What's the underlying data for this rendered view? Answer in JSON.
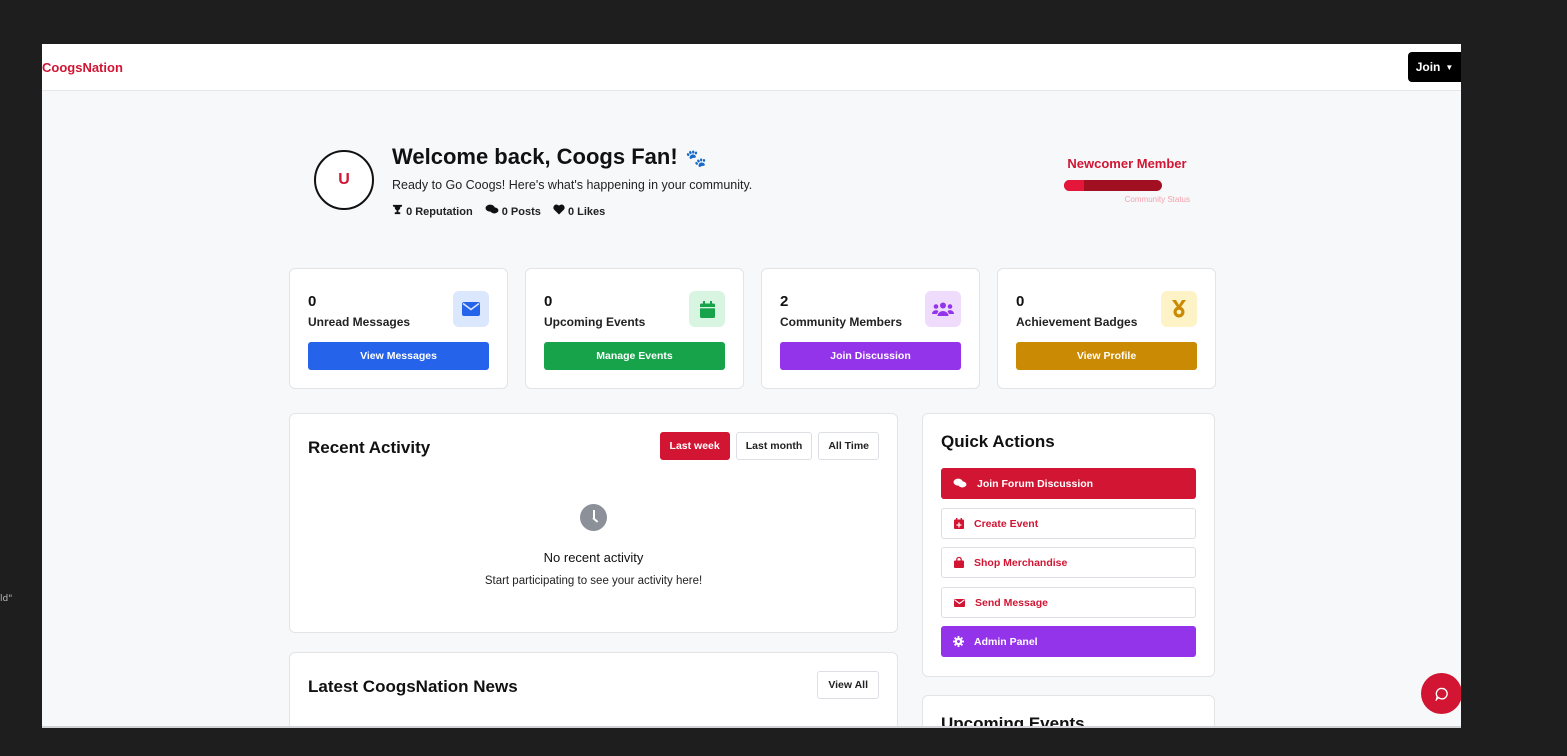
{
  "outer": {
    "left_fragment": "ld\""
  },
  "navbar": {
    "brand": "CoogsNation",
    "join_label": "Join",
    "join_caret": "▼"
  },
  "welcome": {
    "avatar_letter": "U",
    "title": "Welcome back, Coogs Fan!",
    "title_emoji": "🐾",
    "subtitle": "Ready to Go Coogs! Here's what's happening in your community.",
    "stats": [
      {
        "icon": "trophy-icon",
        "label": "0 Reputation"
      },
      {
        "icon": "comments-icon",
        "label": "0 Posts"
      },
      {
        "icon": "heart-icon",
        "label": "0 Likes"
      }
    ]
  },
  "member": {
    "label": "Newcomer Member",
    "status": "Community Status",
    "progress": 0.2
  },
  "cards": [
    {
      "value": "0",
      "label": "Unread Messages",
      "button": "View Messages",
      "icon": "envelope-icon",
      "color": "#2563eb",
      "icon_bg": "#dbe7fd"
    },
    {
      "value": "0",
      "label": "Upcoming Events",
      "button": "Manage Events",
      "icon": "calendar-icon",
      "color": "#16a34a",
      "icon_bg": "#d7f5e0"
    },
    {
      "value": "2",
      "label": "Community Members",
      "button": "Join Discussion",
      "icon": "users-icon",
      "color": "#9333ea",
      "icon_bg": "#efdcfd"
    },
    {
      "value": "0",
      "label": "Achievement Badges",
      "button": "View Profile",
      "icon": "medal-icon",
      "color": "#ca8a04",
      "icon_bg": "#fdf3c6"
    }
  ],
  "recent": {
    "title": "Recent Activity",
    "filters": [
      "Last week",
      "Last month",
      "All Time"
    ],
    "active_filter": "Last week",
    "empty_title": "No recent activity",
    "empty_sub": "Start participating to see your activity here!"
  },
  "news": {
    "title": "Latest CoogsNation News",
    "view_all": "View All"
  },
  "quick": {
    "title": "Quick Actions",
    "actions": [
      {
        "label": "Join Forum Discussion",
        "icon": "comments-icon",
        "style": "red"
      },
      {
        "label": "Create Event",
        "icon": "calendar-icon",
        "style": "outline"
      },
      {
        "label": "Shop Merchandise",
        "icon": "shopping-bag-icon",
        "style": "outline"
      },
      {
        "label": "Send Message",
        "icon": "envelope-icon",
        "style": "outline"
      },
      {
        "label": "Admin Panel",
        "icon": "gear-icon",
        "style": "purple"
      }
    ]
  },
  "upcoming": {
    "title": "Upcoming Events"
  },
  "colors": {
    "brand": "#d11533",
    "blue": "#2563eb",
    "green": "#16a34a",
    "purple": "#9333ea",
    "gold": "#ca8a04"
  }
}
